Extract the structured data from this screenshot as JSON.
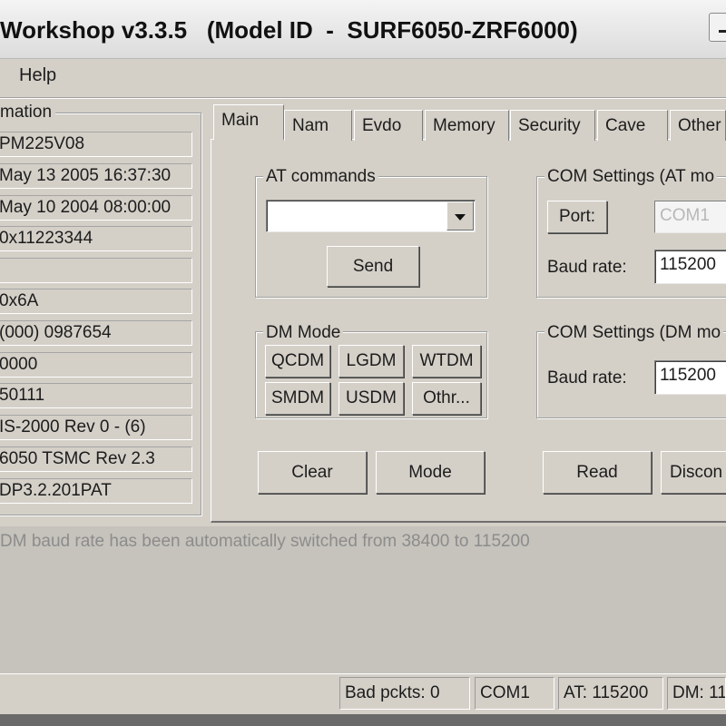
{
  "window": {
    "title": "Workshop v3.3.5   (Model ID  -  SURF6050-ZRF6000)"
  },
  "menu": {
    "items": [
      {
        "label": "Help"
      }
    ]
  },
  "info_panel": {
    "label": "mation",
    "fields": [
      "PM225V08",
      "May 13 2005 16:37:30",
      "May 10 2004 08:00:00",
      "0x11223344",
      "",
      "0x6A",
      "(000) 0987654",
      "0000",
      "50111",
      "IS-2000 Rev 0 - (6)",
      "6050 TSMC Rev 2.3",
      "DP3.2.201PAT"
    ]
  },
  "tabs": [
    {
      "label": "Main",
      "active": true
    },
    {
      "label": "Nam"
    },
    {
      "label": "Evdo"
    },
    {
      "label": "Memory"
    },
    {
      "label": "Security"
    },
    {
      "label": "Cave"
    },
    {
      "label": "Other"
    }
  ],
  "at_commands": {
    "label": "AT commands",
    "value": "",
    "send_label": "Send"
  },
  "dm_mode": {
    "label": "DM Mode",
    "buttons": [
      "QCDM",
      "LGDM",
      "WTDM",
      "SMDM",
      "USDM",
      "Othr..."
    ]
  },
  "com_at": {
    "label": "COM Settings (AT mo",
    "port_label": "Port:",
    "port_value": "COM1",
    "baud_label": "Baud rate:",
    "baud_value": "115200"
  },
  "com_dm": {
    "label": "COM Settings (DM mo",
    "baud_label": "Baud rate:",
    "baud_value": "115200"
  },
  "actions": {
    "clear": "Clear",
    "mode": "Mode",
    "read": "Read",
    "disconnect": "Discon"
  },
  "status_message": "DM baud rate has been automatically switched from 38400 to 115200",
  "statusbar": {
    "bad_packets": "Bad pckts: 0",
    "port": "COM1",
    "at": "AT: 115200",
    "dm": "DM: 11"
  },
  "colors": {
    "face": "#d4d0c8",
    "status_text": "#8c8c8c"
  }
}
